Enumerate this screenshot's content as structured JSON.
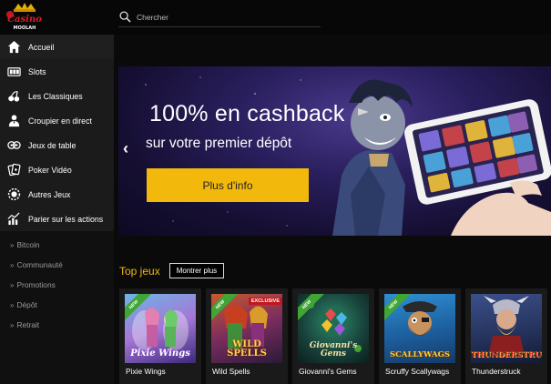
{
  "logo": {
    "text_top": "CASINO",
    "text_bottom": "MOOLAH"
  },
  "search": {
    "placeholder": "Chercher"
  },
  "nav": {
    "main": [
      {
        "label": "Accueil",
        "icon": "home-icon"
      },
      {
        "label": "Slots",
        "icon": "slot-machine-icon"
      },
      {
        "label": "Les Classiques",
        "icon": "classics-icon"
      },
      {
        "label": "Croupier en direct",
        "icon": "dealer-icon"
      },
      {
        "label": "Jeux de table",
        "icon": "table-games-icon"
      },
      {
        "label": "Poker Vidéo",
        "icon": "poker-icon"
      },
      {
        "label": "Autres Jeux",
        "icon": "other-games-icon"
      },
      {
        "label": "Parier sur les actions",
        "icon": "chart-icon"
      }
    ],
    "secondary": [
      {
        "label": "Bitcoin"
      },
      {
        "label": "Communauté"
      },
      {
        "label": "Promotions"
      },
      {
        "label": "Dépôt"
      },
      {
        "label": "Retrait"
      }
    ]
  },
  "hero": {
    "title": "100% en cashback",
    "subtitle": "sur votre premier dépôt",
    "button": "Plus d'info",
    "prev_arrow": "‹"
  },
  "top_games": {
    "title": "Top jeux",
    "more_button": "Montrer plus",
    "games": [
      {
        "name": "Pixie Wings",
        "art_title": "Pixie Wings",
        "badge": "NEW",
        "exclusive": ""
      },
      {
        "name": "Wild Spells",
        "art_title": "WILD SPELLS",
        "badge": "NEW",
        "exclusive": "EXCLUSIVE"
      },
      {
        "name": "Giovanni's Gems",
        "art_title": "Giovanni's Gems",
        "badge": "NEW",
        "exclusive": ""
      },
      {
        "name": "Scruffy Scallywags",
        "art_title": "SCALLYWAGS",
        "badge": "NEW",
        "exclusive": ""
      },
      {
        "name": "Thunderstruck",
        "art_title": "THUNDERSTRUCK",
        "badge": "",
        "exclusive": ""
      }
    ]
  },
  "colors": {
    "accent": "#f2b90c",
    "sidebar": "#101010",
    "active": "#1f1f1f",
    "badge_new": "#3fa535",
    "badge_exclusive": "#c0181e"
  }
}
